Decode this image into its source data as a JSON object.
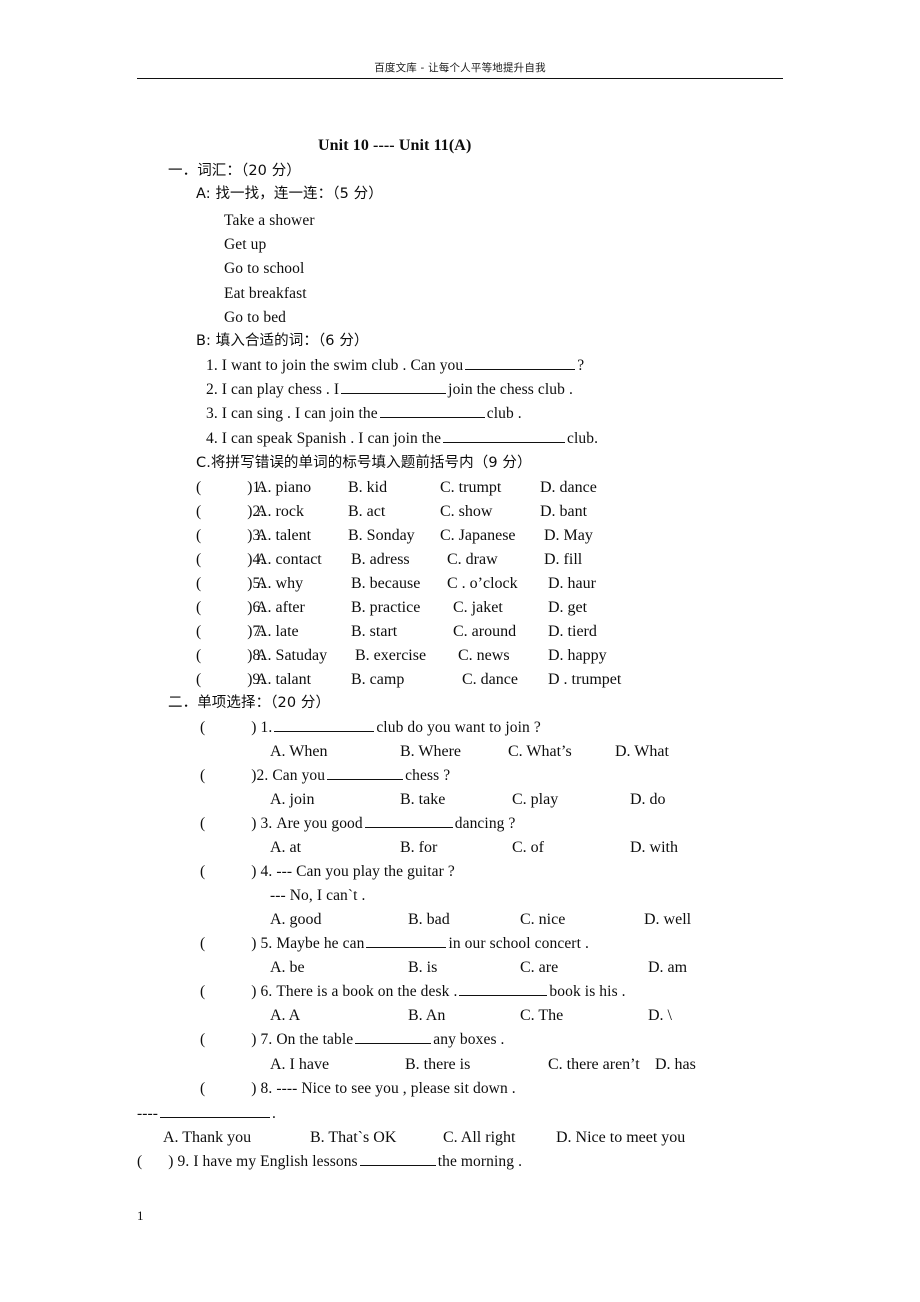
{
  "header": {
    "watermark": "百度文库 - 让每个人平等地提升自我"
  },
  "document": {
    "title": "Unit 10 ---- Unit 11(A)",
    "page_number": "1"
  },
  "section_one": {
    "heading": "一．词汇：（20 分）",
    "part_a": {
      "heading": "A: 找一找，连一连：（5 分）",
      "items": [
        "Take a shower",
        "Get up",
        "Go to school",
        "Eat breakfast",
        "Go to bed"
      ]
    },
    "part_b": {
      "heading": "B: 填入合适的词：（6 分）",
      "questions": [
        {
          "pre": "1. I want to join the swim club . Can you",
          "blank_width": 110,
          "post": "?"
        },
        {
          "pre": "2. I can play chess . I",
          "blank_width": 105,
          "post": "join the chess club ."
        },
        {
          "pre": "3. I can sing . I can join the",
          "blank_width": 105,
          "post": "club ."
        },
        {
          "pre": "4. I can speak Spanish . I can join the",
          "blank_width": 120,
          "post": "club."
        }
      ]
    },
    "part_c": {
      "heading": "C.将拼写错误的单词的标号填入题前括号内（9 分）",
      "questions": [
        {
          "num": ")1.",
          "a": "A. piano",
          "b": "B. kid",
          "c": "C. trumpt",
          "d": "D. dance"
        },
        {
          "num": ")2.",
          "a": "A. rock",
          "b": "B. act",
          "c": "C. show",
          "d": "D. bant"
        },
        {
          "num": ")3.",
          "a": "A. talent",
          "b": "B. Sonday",
          "c": "C. Japanese",
          "d": "D. May"
        },
        {
          "num": ")4.",
          "a": "A. contact",
          "b": "B. adress",
          "c": "C. draw",
          "d": "D. fill"
        },
        {
          "num": ")5.",
          "a": "A. why",
          "b": "B. because",
          "c": "C . o’clock",
          "d": "D. haur"
        },
        {
          "num": ")6.",
          "a": "A. after",
          "b": "B. practice",
          "c": "C. jaket",
          "d": "D. get"
        },
        {
          "num": ")7.",
          "a": "A. late",
          "b": "B. start",
          "c": "C. around",
          "d": "D. tierd"
        },
        {
          "num": ")8.",
          "a": "A. Satuday",
          "b": "B. exercise",
          "c": "C. news",
          "d": "D. happy"
        },
        {
          "num": ")9.",
          "a": "A. talant",
          "b": "B. camp",
          "c": "C. dance",
          "d": "D . trumpet"
        }
      ]
    }
  },
  "section_two": {
    "heading": "二．单项选择：（20 分）",
    "questions": [
      {
        "num": ") 1.",
        "pre": "",
        "blank_width": 100,
        "post": "club do you want to join ?",
        "options": [
          "A. When",
          "B. Where",
          "C. What’s",
          "D. What"
        ]
      },
      {
        "num": ")2.",
        "pre": "Can you",
        "blank_width": 76,
        "post": "chess ?",
        "options": [
          "A. join",
          "B. take",
          "C. play",
          "D. do"
        ]
      },
      {
        "num": ") 3.",
        "pre": "Are you good",
        "blank_width": 88,
        "post": "dancing ?",
        "options": [
          "A. at",
          "B. for",
          "C. of",
          "D. with"
        ]
      },
      {
        "num": ") 4.",
        "pre": "--- Can you play the guitar ?",
        "blank_width": 0,
        "post": "",
        "extra_line": "--- No, I can`t .",
        "options": [
          "A. good",
          "B. bad",
          "C. nice",
          "D. well"
        ]
      },
      {
        "num": ") 5.",
        "pre": "Maybe he can",
        "blank_width": 80,
        "post": "in our school concert .",
        "options": [
          "A. be",
          "B. is",
          "C. are",
          "D. am"
        ]
      },
      {
        "num": ") 6.",
        "pre": "There is a book on the desk .",
        "blank_width": 88,
        "post": "book is his .",
        "options": [
          "A. A",
          "B. An",
          "C. The",
          "D. \\"
        ]
      },
      {
        "num": ") 7.",
        "pre": "On the table",
        "blank_width": 76,
        "post": "any boxes .",
        "options": [
          "A. I have",
          "B. there is",
          "C. there aren’t",
          "D. has"
        ]
      },
      {
        "num": ") 8.",
        "pre": "---- Nice to see you , please sit down .",
        "blank_width": 0,
        "post": "",
        "wrap_pre": "----",
        "wrap_blank_width": 110,
        "wrap_post": ".",
        "options": [
          "A. Thank you",
          "B. That`s OK",
          "C. All right",
          "D. Nice to meet you"
        ]
      },
      {
        "num": ") 9.",
        "pre": "I have my English lessons",
        "blank_width": 76,
        "post": "the morning .",
        "options": []
      }
    ]
  }
}
